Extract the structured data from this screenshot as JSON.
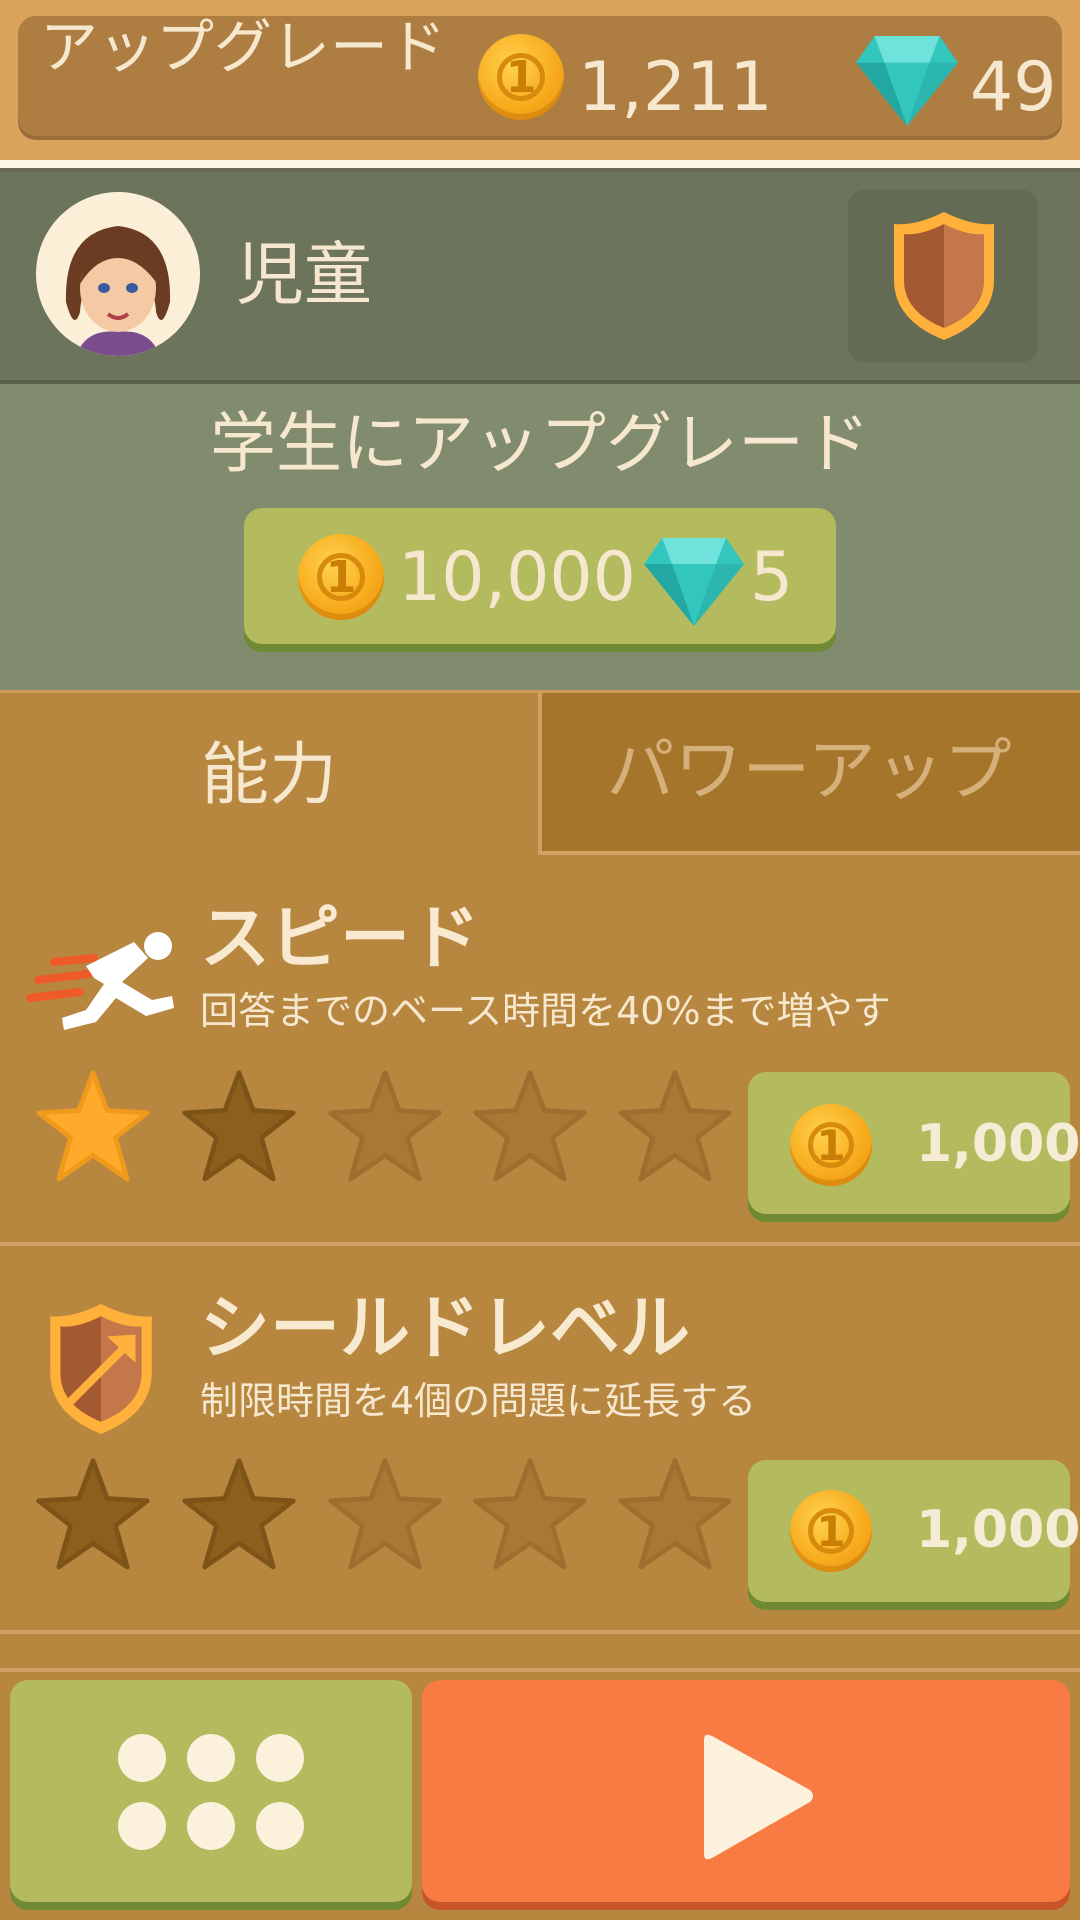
{
  "header": {
    "title": "アップグレード",
    "coins": "1,211",
    "gems": "49"
  },
  "profile": {
    "rank_label": "児童"
  },
  "upgrade": {
    "title": "学生にアップグレード",
    "cost_coins": "10,000",
    "cost_gems": "5"
  },
  "tabs": [
    {
      "label": "能力",
      "selected": true
    },
    {
      "label": "パワーアップ",
      "selected": false
    }
  ],
  "abilities": [
    {
      "icon": "runner-icon",
      "title": "スピード",
      "description": "回答までのベース時間を40%まで増やす",
      "level": 1,
      "max_level": 5,
      "price": "1,000"
    },
    {
      "icon": "shield-arrow-icon",
      "title": "シールドレベル",
      "description": "制限時間を4個の問題に延長する",
      "level": 0,
      "max_level": 5,
      "price": "1,000"
    }
  ],
  "colors": {
    "star_filled": "#ffaa2b",
    "star_unlocked": "#8d5f1d",
    "star_locked": "#a97834",
    "accent_green": "#b4ba5e",
    "accent_orange": "#f77b42"
  }
}
